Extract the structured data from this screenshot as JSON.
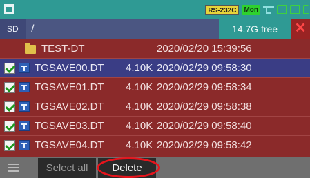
{
  "status": {
    "rs_label": "RS-232C",
    "mon_label": "Mon",
    "icons": [
      "window-icon",
      "usb-icon",
      "signal-icon",
      "sd-icon",
      "monitor-icon"
    ]
  },
  "pathbar": {
    "drive": "SD",
    "path": "/",
    "free": "14.7G free",
    "close": "✕"
  },
  "files": [
    {
      "type": "folder",
      "checked": false,
      "name": "TEST-DT",
      "size": "",
      "date": "2020/02/20 15:39:56"
    },
    {
      "type": "file",
      "checked": true,
      "name": "TGSAVE00.DT",
      "size": "4.10K",
      "date": "2020/02/29 09:58:30"
    },
    {
      "type": "file",
      "checked": true,
      "name": "TGSAVE01.DT",
      "size": "4.10K",
      "date": "2020/02/29 09:58:34"
    },
    {
      "type": "file",
      "checked": true,
      "name": "TGSAVE02.DT",
      "size": "4.10K",
      "date": "2020/02/29 09:58:38"
    },
    {
      "type": "file",
      "checked": true,
      "name": "TGSAVE03.DT",
      "size": "4.10K",
      "date": "2020/02/29 09:58:40"
    },
    {
      "type": "file",
      "checked": true,
      "name": "TGSAVE04.DT",
      "size": "4.10K",
      "date": "2020/02/29 09:58:42"
    }
  ],
  "bottombar": {
    "select_all": "Select all",
    "delete": "Delete"
  },
  "colors": {
    "accent": "#2f9a94",
    "row_bg": "#8b2a2a",
    "selected_bg": "#3a3d85",
    "highlight_circle": "#e8141c"
  }
}
